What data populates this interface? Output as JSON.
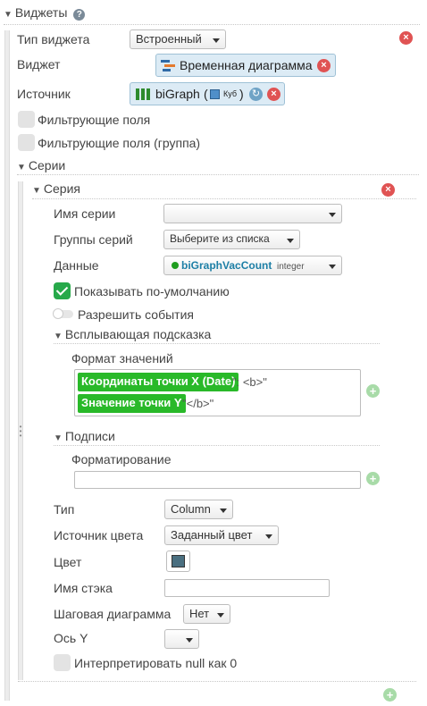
{
  "header": {
    "title": "Виджеты",
    "help_icon": "question-circle-icon"
  },
  "widget": {
    "type_label": "Тип виджета",
    "type_value": "Встроенный",
    "widget_label": "Виджет",
    "widget_value": "Временная диаграмма",
    "source_label": "Источник",
    "source_name": "biGraph",
    "source_paren_open": "(",
    "source_kind": "Куб",
    "source_paren_close": ")",
    "filter_fields": "Фильтрующие поля",
    "filter_fields_group": "Фильтрующие поля (группа)"
  },
  "series_section": {
    "title": "Серии",
    "series": {
      "title": "Серия",
      "name_label": "Имя серии",
      "name_value": "",
      "groups_label": "Группы серий",
      "groups_value": "Выберите из списка",
      "data_label": "Данные",
      "data_value": "biGraphVacCount",
      "data_type": "integer",
      "show_default": "Показывать по-умолчанию",
      "allow_events": "Разрешить события",
      "tooltip": {
        "title": "Всплывающая подсказка",
        "format_label": "Формат значений",
        "line1_tag": "Координаты точки X (Date)",
        "line1_text": "\": <b>\"",
        "line2_tag": "Значение точки Y",
        "line2_text": "\"</b>\""
      },
      "labels": {
        "title": "Подписи",
        "formatting_label": "Форматирование",
        "formatting_value": ""
      },
      "type_label": "Тип",
      "type_value": "Column",
      "color_source_label": "Источник цвета",
      "color_source_value": "Заданный цвет",
      "color_label": "Цвет",
      "color_value": "#4a6f80",
      "stack_label": "Имя стэка",
      "stack_value": "",
      "step_label": "Шаговая диаграмма",
      "step_value": "Нет",
      "axis_y_label": "Ось Y",
      "axis_y_value": "",
      "null_label": "Интерпретировать null как 0"
    }
  },
  "colors": {
    "accent_green": "#29b929",
    "remove_red": "#e05353",
    "chip_blue": "#dcebf5"
  }
}
